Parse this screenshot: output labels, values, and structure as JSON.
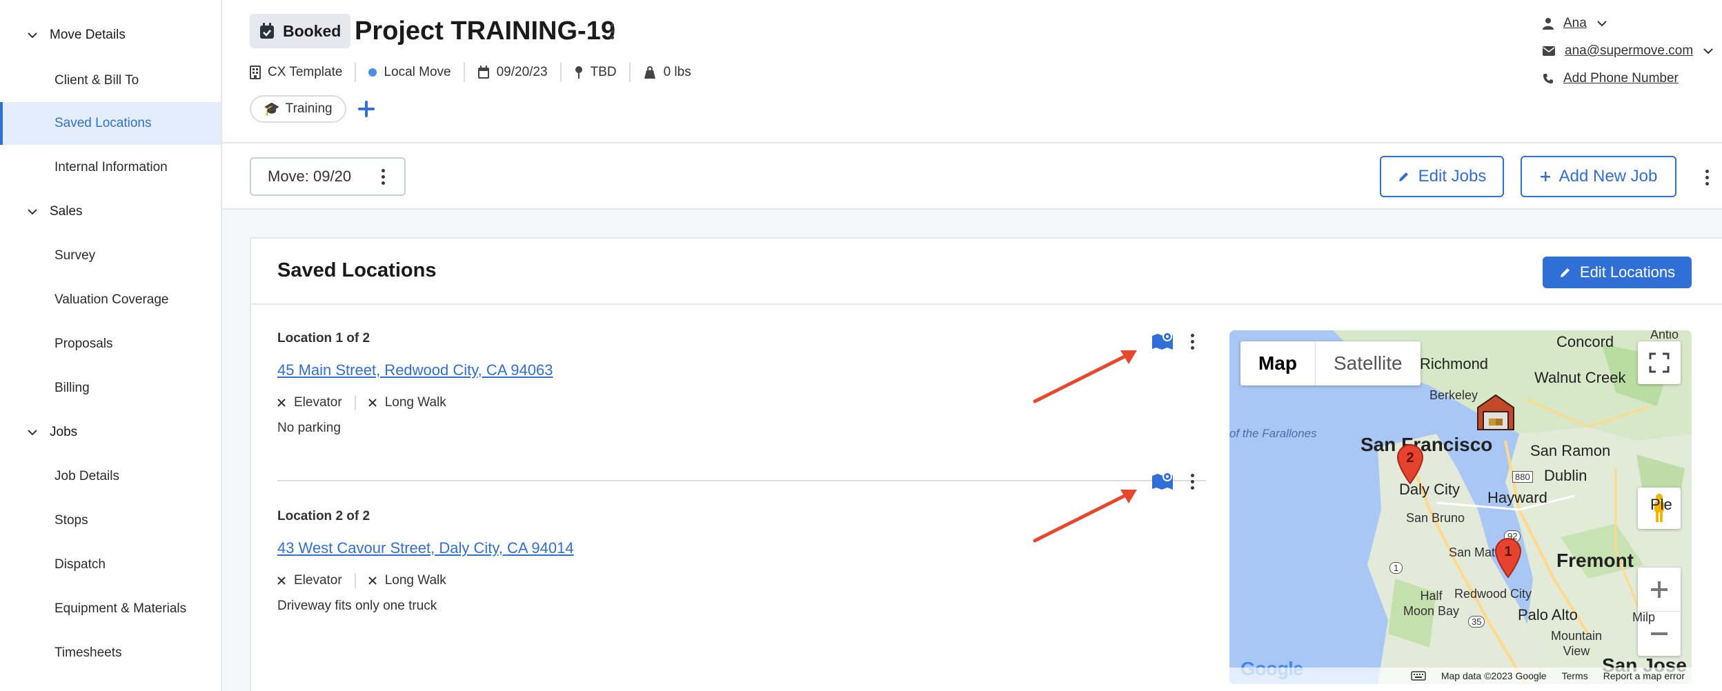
{
  "sidebar": {
    "sections": [
      {
        "label": "Move Details",
        "items": [
          "Client & Bill To",
          "Saved Locations",
          "Internal Information"
        ]
      },
      {
        "label": "Sales",
        "items": [
          "Survey",
          "Valuation Coverage",
          "Proposals",
          "Billing"
        ]
      },
      {
        "label": "Jobs",
        "items": [
          "Job Details",
          "Stops",
          "Dispatch",
          "Equipment & Materials",
          "Timesheets"
        ]
      }
    ],
    "active_item": "Saved Locations"
  },
  "header": {
    "status": "Booked",
    "title": "Project TRAINING-19",
    "meta": {
      "template": "CX Template",
      "move_type": "Local Move",
      "date": "09/20/23",
      "time": "TBD",
      "weight": "0 lbs"
    },
    "tag": "Training",
    "user": {
      "name": "Ana",
      "email": "ana@supermove.com",
      "phone_link": "Add Phone Number"
    }
  },
  "movebar": {
    "move_select": "Move: 09/20",
    "edit_jobs": "Edit Jobs",
    "add_new_job": "Add New Job"
  },
  "saved_locations": {
    "title": "Saved Locations",
    "edit_button": "Edit Locations",
    "locations": [
      {
        "label": "Location 1 of 2",
        "address": "45 Main Street, Redwood City, CA 94063",
        "attributes": [
          "Elevator",
          "Long Walk"
        ],
        "note": "No parking"
      },
      {
        "label": "Location 2 of 2",
        "address": "43 West Cavour Street, Daly City, CA 94014",
        "attributes": [
          "Elevator",
          "Long Walk"
        ],
        "note": "Driveway fits only one truck"
      }
    ]
  },
  "map": {
    "toggle": {
      "map": "Map",
      "satellite": "Satellite"
    },
    "labels": {
      "antio": "Antio",
      "richmond": "Richmond",
      "concord": "Concord",
      "walnut_creek": "Walnut Creek",
      "berkeley": "Berkeley",
      "farallones": "of the Farallones",
      "sf": "San Francisco",
      "san_ramon": "San Ramon",
      "dublin": "Dublin",
      "daly_city": "Daly City",
      "hayward": "Hayward",
      "pleasanton": "Ple",
      "san_bruno": "San Bruno",
      "san_mateo": "San Mateo",
      "fremont": "Fremont",
      "half_moon_bay": "Half\nMoon Bay",
      "redwood_city": "Redwood City",
      "palo_alto": "Palo Alto",
      "mountain_view": "Mountain\nView",
      "milpitas": "Milp",
      "san_jose": "San Jose",
      "hwy_880": "880",
      "hwy_92": "92",
      "hwy_1": "1",
      "hwy_35": "35"
    },
    "pins": [
      "1",
      "2"
    ],
    "footer": {
      "data": "Map data ©2023 Google",
      "terms": "Terms",
      "report": "Report a map error"
    },
    "logo": "Google"
  }
}
